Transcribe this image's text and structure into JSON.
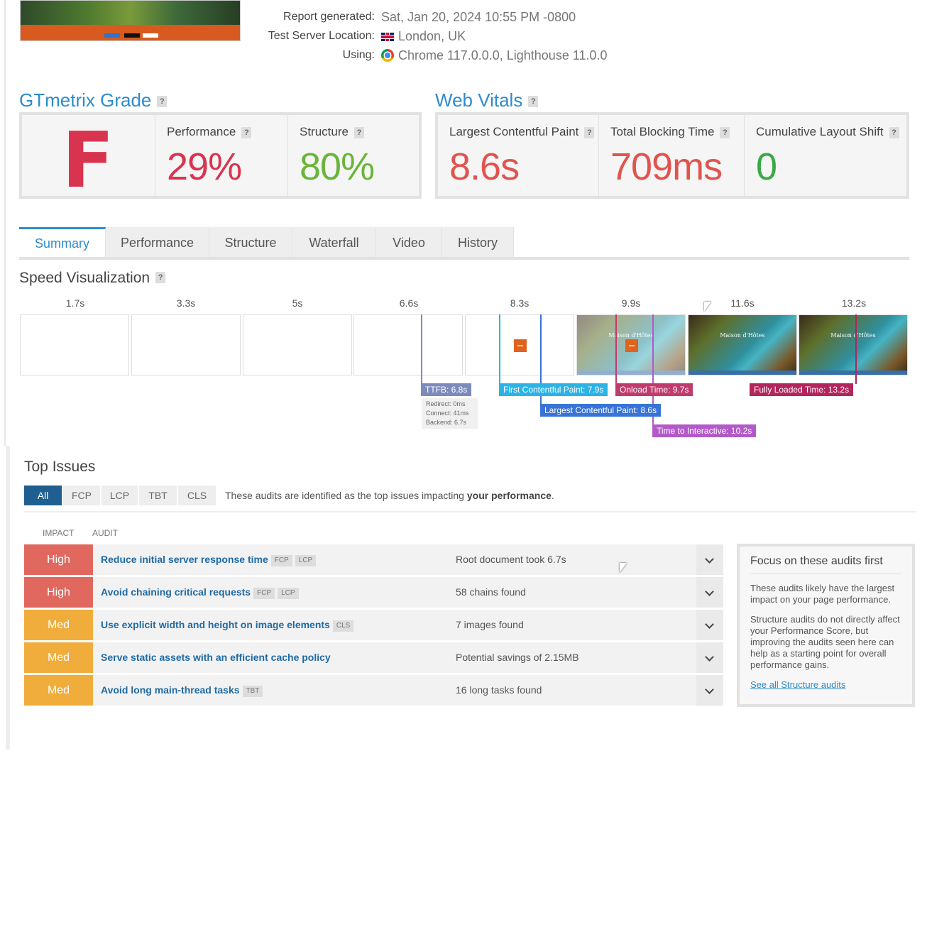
{
  "report": {
    "generated_label": "Report generated:",
    "generated_value": "Sat, Jan 20, 2024 10:55 PM -0800",
    "location_label": "Test Server Location:",
    "location_value": "London, UK",
    "using_label": "Using:",
    "using_value": "Chrome 117.0.0.0, Lighthouse 11.0.0",
    "flag_icon": "uk-flag-icon",
    "browser_icon": "chrome-icon"
  },
  "grade": {
    "title": "GTmetrix Grade",
    "help": "?",
    "letter": "F",
    "performance_label": "Performance",
    "performance_value": "29%",
    "structure_label": "Structure",
    "structure_value": "80%",
    "colors": {
      "bad": "#d9344f",
      "good": "#6ab53a",
      "poor": "#e0544e"
    }
  },
  "vitals": {
    "title": "Web Vitals",
    "help": "?",
    "lcp_label": "Largest Contentful Paint",
    "lcp_value": "8.6s",
    "tbt_label": "Total Blocking Time",
    "tbt_value": "709ms",
    "cls_label": "Cumulative Layout Shift",
    "cls_value": "0"
  },
  "tabs": [
    {
      "label": "Summary",
      "active": true
    },
    {
      "label": "Performance"
    },
    {
      "label": "Structure"
    },
    {
      "label": "Waterfall"
    },
    {
      "label": "Video"
    },
    {
      "label": "History"
    }
  ],
  "speed": {
    "title": "Speed Visualization",
    "help": "?",
    "ticks": [
      "1.7s",
      "3.3s",
      "5s",
      "6.6s",
      "8.3s",
      "9.9s",
      "11.6s",
      "13.2s"
    ],
    "frame_caption": "Maison d'Hôtes",
    "markers": {
      "ttfb": "TTFB: 6.8s",
      "ttfb_detail": [
        "Redirect: 0ms",
        "Connect: 41ms",
        "Backend: 6.7s"
      ],
      "fcp": "First Contentful Paint: 7.9s",
      "onload": "Onload Time: 9.7s",
      "fully": "Fully Loaded Time: 13.2s",
      "lcp": "Largest Contentful Paint: 8.6s",
      "tti": "Time to Interactive: 10.2s"
    },
    "marker_colors": {
      "ttfb": "#7c8bbd",
      "fcp": "#2bb3e6",
      "onload": "#c13a6e",
      "fully": "#b4245d",
      "lcp": "#3873d6",
      "tti": "#b35ac9"
    }
  },
  "issues": {
    "title": "Top Issues",
    "filters": [
      "All",
      "FCP",
      "LCP",
      "TBT",
      "CLS"
    ],
    "note_prefix": "These audits are identified as the top issues impacting ",
    "note_bold": "your performance",
    "note_suffix": ".",
    "col_impact": "IMPACT",
    "col_audit": "AUDIT",
    "rows": [
      {
        "impact": "High",
        "audit": "Reduce initial server response time",
        "tags": [
          "FCP",
          "LCP"
        ],
        "finding": "Root document took 6.7s"
      },
      {
        "impact": "High",
        "audit": "Avoid chaining critical requests",
        "tags": [
          "FCP",
          "LCP"
        ],
        "finding": "58 chains found"
      },
      {
        "impact": "Med",
        "audit": "Use explicit width and height on image elements",
        "tags": [
          "CLS"
        ],
        "finding": "7 images found"
      },
      {
        "impact": "Med",
        "audit": "Serve static assets with an efficient cache policy",
        "tags": [],
        "finding": "Potential savings of 2.15MB"
      },
      {
        "impact": "Med",
        "audit": "Avoid long main-thread tasks",
        "tags": [
          "TBT"
        ],
        "finding": "16 long tasks found"
      }
    ],
    "impact_colors": {
      "High": "#e0685f",
      "Med": "#f0ad3c"
    }
  },
  "focus": {
    "title": "Focus on these audits first",
    "p1": "These audits likely have the largest impact on your page performance.",
    "p2": "Structure audits do not directly affect your Performance Score, but improving the audits seen here can help as a starting point for overall performance gains.",
    "link": "See all Structure audits"
  }
}
